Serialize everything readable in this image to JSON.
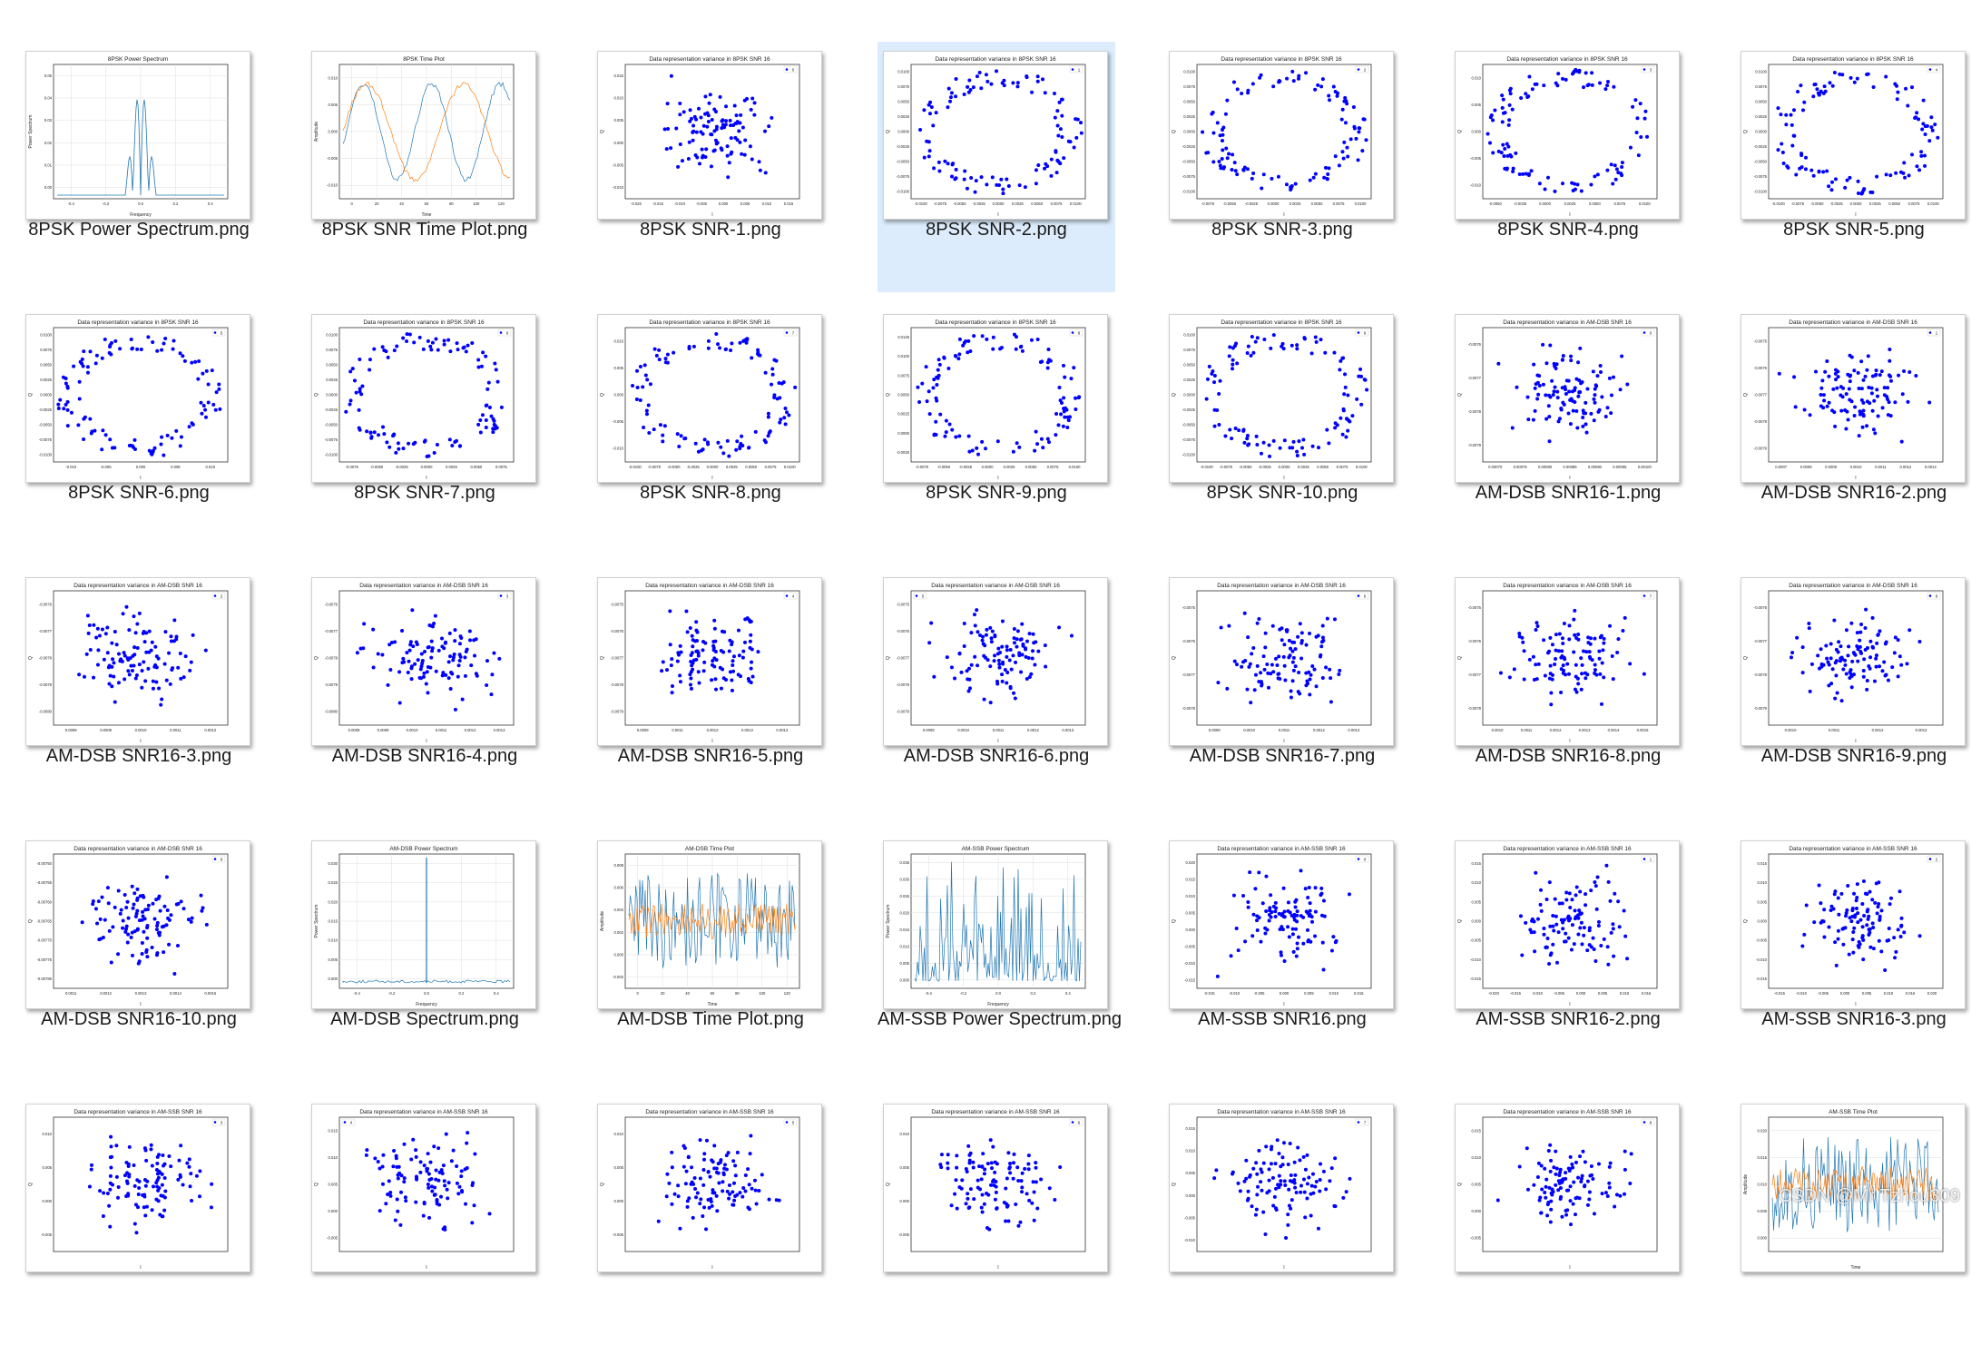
{
  "watermark": "CSDN @Mr Tzhou309",
  "files": [
    {
      "name": "8PSK Power Spectrum.png",
      "plot": {
        "kind": "spectrum",
        "title": "8PSK Power Spectrum",
        "ylabel": "Power Spectrum",
        "xlabel": "Frequency",
        "xticks": [
          "-0.4",
          "-0.2",
          "0.0",
          "0.2",
          "0.4"
        ],
        "yticks": [
          "0.00",
          "0.01",
          "0.02",
          "0.03",
          "0.04",
          "0.05"
        ]
      }
    },
    {
      "name": "8PSK SNR Time Plot.png",
      "plot": {
        "kind": "time",
        "title": "8PSK Time Plot",
        "ylabel": "Amplitude",
        "xlabel": "Time",
        "xticks": [
          "0",
          "20",
          "40",
          "60",
          "80",
          "100",
          "120"
        ],
        "yticks": [
          "-0.010",
          "-0.005",
          "0.000",
          "0.005",
          "0.010"
        ]
      }
    },
    {
      "name": "8PSK SNR-1.png",
      "plot": {
        "kind": "scatter",
        "shape": "blob",
        "legend": "0",
        "title": "Data representation variance in 8PSK SNR 16",
        "ylabel": "Q",
        "xlabel": "I",
        "xticks": [
          "-0.020",
          "-0.015",
          "-0.010",
          "-0.005",
          "0.000",
          "0.005",
          "0.010",
          "0.015"
        ],
        "yticks": [
          "-0.010",
          "-0.005",
          "0.000",
          "0.005",
          "0.010",
          "0.015"
        ]
      }
    },
    {
      "name": "8PSK SNR-2.png",
      "selected": true,
      "plot": {
        "kind": "scatter",
        "shape": "ring",
        "legend": "1",
        "title": "Data representation variance in 8PSK SNR 16",
        "ylabel": "Q",
        "xlabel": "I",
        "xticks": [
          "-0.0100",
          "-0.0075",
          "-0.0050",
          "-0.0025",
          "0.0000",
          "0.0025",
          "0.0050",
          "0.0075",
          "0.0100"
        ],
        "yticks": [
          "-0.0100",
          "-0.0075",
          "-0.0050",
          "-0.0025",
          "0.0000",
          "0.0025",
          "0.0050",
          "0.0075",
          "0.0100"
        ]
      }
    },
    {
      "name": "8PSK SNR-3.png",
      "plot": {
        "kind": "scatter",
        "shape": "ring",
        "legend": "2",
        "title": "Data representation variance in 8PSK SNR 16",
        "ylabel": "Q",
        "xlabel": "I",
        "xticks": [
          "-0.0075",
          "-0.0050",
          "-0.0025",
          "0.0000",
          "0.0025",
          "0.0050",
          "0.0075",
          "0.0100"
        ],
        "yticks": [
          "-0.0100",
          "-0.0075",
          "-0.0050",
          "-0.0025",
          "0.0000",
          "0.0025",
          "0.0050",
          "0.0075",
          "0.0100"
        ]
      }
    },
    {
      "name": "8PSK SNR-4.png",
      "plot": {
        "kind": "scatter",
        "shape": "ring",
        "legend": "3",
        "title": "Data representation variance in 8PSK SNR 16",
        "ylabel": "Q",
        "xlabel": "I",
        "xticks": [
          "-0.0050",
          "-0.0025",
          "0.0000",
          "0.0025",
          "0.0050",
          "0.0075",
          "0.0100"
        ],
        "yticks": [
          "-0.010",
          "-0.005",
          "0.000",
          "0.005",
          "0.010"
        ]
      }
    },
    {
      "name": "8PSK SNR-5.png",
      "plot": {
        "kind": "scatter",
        "shape": "ring",
        "legend": "4",
        "title": "Data representation variance in 8PSK SNR 16",
        "ylabel": "Q",
        "xlabel": "I",
        "xticks": [
          "-0.0100",
          "-0.0075",
          "-0.0050",
          "-0.0025",
          "0.0000",
          "0.0025",
          "0.0050",
          "0.0075",
          "0.0100"
        ],
        "yticks": [
          "-0.0100",
          "-0.0075",
          "-0.0050",
          "-0.0025",
          "0.0000",
          "0.0025",
          "0.0050",
          "0.0075",
          "0.0100"
        ]
      }
    },
    {
      "name": "8PSK SNR-6.png",
      "plot": {
        "kind": "scatter",
        "shape": "ring",
        "legend": "5",
        "title": "Data representation variance in 8PSK SNR 16",
        "ylabel": "Q",
        "xlabel": "I",
        "xticks": [
          "-0.010",
          "-0.005",
          "0.000",
          "0.005",
          "0.010"
        ],
        "yticks": [
          "-0.0100",
          "-0.0075",
          "-0.0050",
          "-0.0025",
          "0.0000",
          "0.0025",
          "0.0050",
          "0.0075",
          "0.0100"
        ]
      }
    },
    {
      "name": "8PSK SNR-7.png",
      "plot": {
        "kind": "scatter",
        "shape": "ring",
        "legend": "6",
        "title": "Data representation variance in 8PSK SNR 16",
        "ylabel": "Q",
        "xlabel": "I",
        "xticks": [
          "-0.0075",
          "-0.0050",
          "-0.0025",
          "0.0000",
          "0.0025",
          "0.0050",
          "0.0075"
        ],
        "yticks": [
          "-0.0100",
          "-0.0075",
          "-0.0050",
          "-0.0025",
          "0.0000",
          "0.0025",
          "0.0050",
          "0.0075",
          "0.0100"
        ]
      }
    },
    {
      "name": "8PSK SNR-8.png",
      "plot": {
        "kind": "scatter",
        "shape": "ring",
        "legend": "7",
        "title": "Data representation variance in 8PSK SNR 16",
        "ylabel": "Q",
        "xlabel": "I",
        "xticks": [
          "-0.0100",
          "-0.0075",
          "-0.0050",
          "-0.0025",
          "0.0000",
          "0.0025",
          "0.0050",
          "0.0075",
          "0.0100"
        ],
        "yticks": [
          "-0.010",
          "-0.005",
          "0.000",
          "0.005",
          "0.010"
        ]
      }
    },
    {
      "name": "8PSK SNR-9.png",
      "plot": {
        "kind": "scatter",
        "shape": "ring",
        "legend": "8",
        "title": "Data representation variance in 8PSK SNR 16",
        "ylabel": "Q",
        "xlabel": "I",
        "xticks": [
          "-0.0075",
          "-0.0050",
          "-0.0025",
          "0.0000",
          "0.0025",
          "0.0050",
          "0.0075",
          "0.0100"
        ],
        "yticks": [
          "-0.0025",
          "0.0000",
          "0.0025",
          "0.0050",
          "0.0075",
          "0.0100",
          "0.0125"
        ]
      }
    },
    {
      "name": "8PSK SNR-10.png",
      "plot": {
        "kind": "scatter",
        "shape": "ring",
        "legend": "9",
        "title": "Data representation variance in 8PSK SNR 16",
        "ylabel": "Q",
        "xlabel": "I",
        "xticks": [
          "-0.0100",
          "-0.0075",
          "-0.0050",
          "-0.0025",
          "0.0000",
          "0.0025",
          "0.0050",
          "0.0075",
          "0.0100"
        ],
        "yticks": [
          "-0.0100",
          "-0.0075",
          "-0.0050",
          "-0.0025",
          "0.0000",
          "0.0025",
          "0.0050",
          "0.0075",
          "0.0100"
        ]
      }
    },
    {
      "name": "AM-DSB SNR16-1.png",
      "plot": {
        "kind": "scatter",
        "shape": "blob",
        "legend": "0",
        "title": "Data representation variance in AM-DSB SNR 16",
        "ylabel": "Q",
        "xlabel": "I",
        "xticks": [
          "0.00070",
          "0.00075",
          "0.00080",
          "0.00085",
          "0.00090",
          "0.00095",
          "0.00100"
        ],
        "yticks": [
          "-0.0079",
          "-0.0078",
          "-0.0077",
          "-0.0076"
        ]
      }
    },
    {
      "name": "AM-DSB SNR16-2.png",
      "plot": {
        "kind": "scatter",
        "shape": "blob",
        "legend": "1",
        "title": "Data representation variance in AM-DSB SNR 16",
        "ylabel": "Q",
        "xlabel": "I",
        "xticks": [
          "0.0007",
          "0.0008",
          "0.0009",
          "0.0010",
          "0.0011",
          "0.0012",
          "0.0013"
        ],
        "yticks": [
          "-0.0079",
          "-0.0078",
          "-0.0077",
          "-0.0076",
          "-0.0075"
        ]
      }
    },
    {
      "name": "AM-DSB SNR16-3.png",
      "plot": {
        "kind": "scatter",
        "shape": "blob",
        "legend": "2",
        "title": "Data representation variance in AM-DSB SNR 16",
        "ylabel": "Q",
        "xlabel": "I",
        "xticks": [
          "0.0008",
          "0.0009",
          "0.0010",
          "0.0011",
          "0.0012"
        ],
        "yticks": [
          "-0.0080",
          "-0.0079",
          "-0.0078",
          "-0.0077",
          "-0.0076"
        ]
      }
    },
    {
      "name": "AM-DSB SNR16-4.png",
      "plot": {
        "kind": "scatter",
        "shape": "blob",
        "legend": "3",
        "title": "Data representation variance in AM-DSB SNR 16",
        "ylabel": "Q",
        "xlabel": "I",
        "xticks": [
          "0.0008",
          "0.0009",
          "0.0010",
          "0.0011",
          "0.0012",
          "0.0013"
        ],
        "yticks": [
          "-0.0080",
          "-0.0079",
          "-0.0078",
          "-0.0077",
          "-0.0076"
        ]
      }
    },
    {
      "name": "AM-DSB SNR16-5.png",
      "plot": {
        "kind": "scatter",
        "shape": "blob",
        "legend": "4",
        "title": "Data representation variance in AM-DSB SNR 16",
        "ylabel": "Q",
        "xlabel": "I",
        "xticks": [
          "0.0009",
          "0.0011",
          "0.0012",
          "0.0013",
          "0.0013"
        ],
        "yticks": [
          "-0.0079",
          "-0.0078",
          "-0.0077",
          "-0.0076",
          "-0.0075"
        ]
      }
    },
    {
      "name": "AM-DSB SNR16-6.png",
      "plot": {
        "kind": "scatter",
        "shape": "blob",
        "legend": "5",
        "legendLeft": true,
        "title": "Data representation variance in AM-DSB SNR 16",
        "ylabel": "Q",
        "xlabel": "I",
        "xticks": [
          "0.0009",
          "0.0010",
          "0.0011",
          "0.0012",
          "0.0013"
        ],
        "yticks": [
          "-0.0079",
          "-0.0078",
          "-0.0077",
          "-0.0076",
          "-0.0075"
        ]
      }
    },
    {
      "name": "AM-DSB SNR16-7.png",
      "plot": {
        "kind": "scatter",
        "shape": "blob",
        "legend": "6",
        "title": "Data representation variance in AM-DSB SNR 16",
        "ylabel": "Q",
        "xlabel": "I",
        "xticks": [
          "0.0009",
          "0.0010",
          "0.0011",
          "0.0012",
          "0.0013"
        ],
        "yticks": [
          "-0.0078",
          "-0.0077",
          "-0.0076",
          "-0.0075"
        ]
      }
    },
    {
      "name": "AM-DSB SNR16-8.png",
      "plot": {
        "kind": "scatter",
        "shape": "blob",
        "legend": "7",
        "title": "Data representation variance in AM-DSB SNR 16",
        "ylabel": "Q",
        "xlabel": "I",
        "xticks": [
          "0.0010",
          "0.0011",
          "0.0012",
          "0.0013",
          "0.0014",
          "0.0015"
        ],
        "yticks": [
          "-0.0078",
          "-0.0077",
          "-0.0076",
          "-0.0075"
        ]
      }
    },
    {
      "name": "AM-DSB SNR16-9.png",
      "plot": {
        "kind": "scatter",
        "shape": "blob",
        "legend": "8",
        "title": "Data representation variance in AM-DSB SNR 16",
        "ylabel": "Q",
        "xlabel": "I",
        "xticks": [
          "0.0010",
          "0.0011",
          "0.0012",
          "0.0013"
        ],
        "yticks": [
          "-0.0079",
          "-0.0078",
          "-0.0077",
          "-0.0076"
        ]
      }
    },
    {
      "name": "AM-DSB SNR16-10.png",
      "plot": {
        "kind": "scatter",
        "shape": "blob",
        "legend": "9",
        "title": "Data representation variance in AM-DSB SNR 16",
        "ylabel": "Q",
        "xlabel": "I",
        "xticks": [
          "0.0011",
          "0.0012",
          "0.0013",
          "0.0014",
          "0.0015"
        ],
        "yticks": [
          "-0.00780",
          "-0.00775",
          "-0.00770",
          "-0.00765",
          "-0.00760",
          "-0.00755",
          "-0.00750"
        ]
      }
    },
    {
      "name": "AM-DSB Spectrum.png",
      "plot": {
        "kind": "spike",
        "title": "AM-DSB Power Spectrum",
        "ylabel": "Power Spectrum",
        "xlabel": "Frequency",
        "xticks": [
          "-0.4",
          "-0.2",
          "0.0",
          "0.2",
          "0.4"
        ],
        "yticks": [
          "0.000",
          "0.005",
          "0.010",
          "0.015",
          "0.020",
          "0.025",
          "0.030"
        ]
      }
    },
    {
      "name": "AM-DSB Time Plot.png",
      "plot": {
        "kind": "noisytime",
        "title": "AM-DSB Time Plot",
        "ylabel": "Amplitude",
        "xlabel": "Time",
        "xticks": [
          "0",
          "20",
          "40",
          "60",
          "80",
          "100",
          "120"
        ],
        "yticks": [
          "-0.002",
          "0.000",
          "0.002",
          "0.004",
          "0.006",
          "0.008"
        ]
      }
    },
    {
      "name": "AM-SSB Power Spectrum.png",
      "plot": {
        "kind": "noisyspectrum",
        "title": "AM-SSB Power Spectrum",
        "ylabel": "Power Spectrum",
        "xlabel": "Frequency",
        "xticks": [
          "-0.4",
          "-0.2",
          "0.0",
          "0.2",
          "0.4"
        ],
        "yticks": [
          "0.000",
          "0.005",
          "0.010",
          "0.015",
          "0.020",
          "0.025",
          "0.030",
          "0.035"
        ]
      }
    },
    {
      "name": "AM-SSB SNR16.png",
      "plot": {
        "kind": "scatter",
        "shape": "blob",
        "legend": "0",
        "title": "Data representation variance in AM-SSB SNR 16",
        "ylabel": "Q",
        "xlabel": "I",
        "xticks": [
          "-0.015",
          "-0.010",
          "-0.005",
          "0.000",
          "0.005",
          "0.010",
          "0.015"
        ],
        "yticks": [
          "-0.015",
          "-0.010",
          "-0.005",
          "0.000",
          "0.005",
          "0.010",
          "0.015",
          "0.020"
        ]
      }
    },
    {
      "name": "AM-SSB SNR16-2.png",
      "plot": {
        "kind": "scatter",
        "shape": "blob",
        "legend": "1",
        "title": "Data representation variance in AM-SSB SNR 16",
        "ylabel": "Q",
        "xlabel": "I",
        "xticks": [
          "-0.020",
          "-0.015",
          "-0.010",
          "-0.005",
          "0.000",
          "0.005",
          "0.010",
          "0.015"
        ],
        "yticks": [
          "-0.015",
          "-0.010",
          "-0.005",
          "0.000",
          "0.005",
          "0.010",
          "0.015"
        ]
      }
    },
    {
      "name": "AM-SSB SNR16-3.png",
      "plot": {
        "kind": "scatter",
        "shape": "blob",
        "legend": "2",
        "title": "Data representation variance in AM-SSB SNR 16",
        "ylabel": "Q",
        "xlabel": "I",
        "xticks": [
          "-0.015",
          "-0.010",
          "-0.005",
          "0.000",
          "0.005",
          "0.010",
          "0.015",
          "0.020"
        ],
        "yticks": [
          "-0.015",
          "-0.010",
          "-0.005",
          "0.000",
          "0.005",
          "0.010",
          "0.015"
        ]
      }
    },
    {
      "name": "",
      "plot": {
        "kind": "scatter",
        "shape": "blob",
        "legend": "3",
        "title": "Data representation variance in AM-SSB SNR 16",
        "ylabel": "Q",
        "xlabel": "I",
        "xticks": [],
        "yticks": [
          "-0.005",
          "0.000",
          "0.005",
          "0.010"
        ]
      }
    },
    {
      "name": "",
      "plot": {
        "kind": "scatter",
        "shape": "blob",
        "legend": "4",
        "legendLeft": true,
        "title": "Data representation variance in AM-SSB SNR 16",
        "ylabel": "Q",
        "xlabel": "I",
        "xticks": [],
        "yticks": [
          "-0.005",
          "0.000",
          "0.005",
          "0.010",
          "0.015"
        ]
      }
    },
    {
      "name": "",
      "plot": {
        "kind": "scatter",
        "shape": "blob",
        "legend": "5",
        "title": "Data representation variance in AM-SSB SNR 16",
        "ylabel": "Q",
        "xlabel": "I",
        "xticks": [],
        "yticks": [
          "-0.005",
          "0.000",
          "0.005",
          "0.010"
        ]
      }
    },
    {
      "name": "",
      "plot": {
        "kind": "scatter",
        "shape": "blob",
        "legend": "6",
        "title": "Data representation variance in AM-SSB SNR 16",
        "ylabel": "Q",
        "xlabel": "I",
        "xticks": [],
        "yticks": [
          "-0.005",
          "0.000",
          "0.005",
          "0.010"
        ]
      }
    },
    {
      "name": "",
      "plot": {
        "kind": "scatter",
        "shape": "blob",
        "legend": "7",
        "title": "Data representation variance in AM-SSB SNR 16",
        "ylabel": "Q",
        "xlabel": "I",
        "xticks": [],
        "yticks": [
          "-0.010",
          "-0.005",
          "0.000",
          "0.005",
          "0.010",
          "0.015"
        ]
      }
    },
    {
      "name": "",
      "plot": {
        "kind": "scatter",
        "shape": "blob",
        "legend": "8",
        "title": "Data representation variance in AM-SSB SNR 16",
        "ylabel": "Q",
        "xlabel": "I",
        "xticks": [],
        "yticks": [
          "-0.005",
          "0.000",
          "0.005",
          "0.010",
          "0.015"
        ]
      }
    },
    {
      "name": "",
      "plot": {
        "kind": "noisytime",
        "title": "AM-SSB Time Plot",
        "ylabel": "Amplitude",
        "xlabel": "Time",
        "xticks": [],
        "yticks": [
          "0.000",
          "0.005",
          "0.010",
          "0.015",
          "0.020"
        ]
      }
    }
  ],
  "colors": {
    "scatter": "#0000ff",
    "line1": "#1f77b4",
    "line2": "#ff7f0e",
    "selected": "#dcecfc"
  }
}
